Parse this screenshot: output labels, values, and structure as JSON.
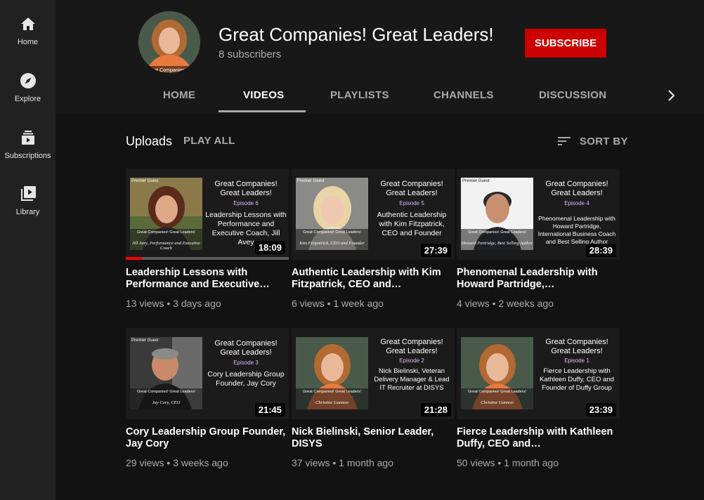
{
  "sidebar": {
    "items": [
      {
        "label": "Home",
        "icon": "home-icon"
      },
      {
        "label": "Explore",
        "icon": "compass-icon"
      },
      {
        "label": "Subscriptions",
        "icon": "subscriptions-icon"
      },
      {
        "label": "Library",
        "icon": "library-icon"
      }
    ]
  },
  "channel": {
    "title": "Great Companies! Great Leaders!",
    "subscribers": "8 subscribers",
    "subscribe_label": "SUBSCRIBE",
    "avatar_caption": "Great Companies! Gr"
  },
  "tabs": [
    {
      "label": "HOME"
    },
    {
      "label": "VIDEOS"
    },
    {
      "label": "PLAYLISTS"
    },
    {
      "label": "CHANNELS"
    },
    {
      "label": "DISCUSSION"
    }
  ],
  "uploads": {
    "label": "Uploads",
    "play_all": "PLAY ALL",
    "sort_by": "SORT BY"
  },
  "videos": [
    {
      "title": "Leadership Lessons with Performance and Executive…",
      "meta": "13 views • 3 days ago",
      "duration": "18:09",
      "progress": 0.1,
      "thumb": {
        "premier": "Premier Guest",
        "heading": "Great Companies! Great Leaders!",
        "episode": "Episode 6",
        "desc": "Leadership Lessons with Performance and Executive Coach, Jill Avey",
        "strip": "Great Companies! Great Leaders!",
        "sig": "Jill Avey, Performance and Executive Coach"
      }
    },
    {
      "title": "Authentic Leadership with Kim Fitzpatrick, CEO and…",
      "meta": "6 views • 1 week ago",
      "duration": "27:39",
      "thumb": {
        "premier": "Premier Guest",
        "heading": "Great Companies! Great Leaders!",
        "episode": "Episode 5",
        "desc": "Authentic Leadership with Kim Fitzpatrick, CEO and Founder",
        "strip": "Great Companies! Great Leaders!",
        "sig": "Kim Fitzpatrick, CEO and Founder"
      }
    },
    {
      "title": "Phenomenal Leadership with Howard Partridge,…",
      "meta": "4 views • 2 weeks ago",
      "duration": "28:39",
      "thumb": {
        "premier": "Premier Guest",
        "heading": "Great Companies! Great Leaders!",
        "episode": "Episode 4",
        "desc": "Phenomenal Leadership with Howard Partridge, International Business Coach and Best Selling Author",
        "strip": "Great Companies! Great Leaders!",
        "sig": "Howard Partridge, Best Selling Author"
      }
    },
    {
      "title": "Cory Leadership Group Founder, Jay Cory",
      "meta": "29 views • 3 weeks ago",
      "duration": "21:45",
      "thumb": {
        "premier": "Premier Guest",
        "heading": "Great Companies! Great Leaders!",
        "episode": "Episode 3",
        "desc": "Cory Leadership Group Founder, Jay Cory",
        "strip": "Great Companies! Great Leaders!",
        "sig": "Jay Cory, CEO"
      }
    },
    {
      "title": "Nick Bielinski, Senior Leader, DISYS",
      "meta": "37 views • 1 month ago",
      "duration": "21:28",
      "thumb": {
        "premier": "",
        "heading": "Great Companies! Great Leaders!",
        "episode": "Episode 2",
        "desc": "Nick Bielinski, Veteran Delivery Manager & Lead IT Recruiter at DISYS",
        "strip": "Great Companies! Great Leaders!",
        "sig": "Christine Gannon"
      }
    },
    {
      "title": "Fierce Leadership with Kathleen Duffy, CEO and…",
      "meta": "50 views • 1 month ago",
      "duration": "23:39",
      "thumb": {
        "premier": "",
        "heading": "Great Companies! Great Leaders!",
        "episode": "Episode 1",
        "desc": "Fierce Leadership with Kathleen Duffy, CEO and Founder of Duffy Group",
        "strip": "Great Companies! Great Leaders!",
        "sig": "Christine Gannon"
      }
    }
  ],
  "colors": {
    "subscribe": "#cc0000",
    "progress": "#ff0000",
    "background": "#181818",
    "sidebar": "#212121"
  }
}
